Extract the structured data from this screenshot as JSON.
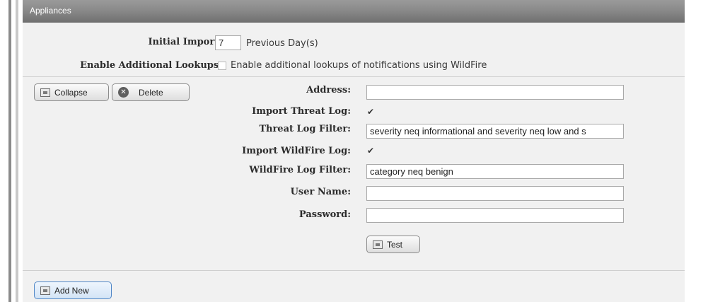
{
  "header": {
    "title": "Appliances"
  },
  "general": {
    "initial_import_label": "Initial Import:",
    "initial_import_value": "7",
    "initial_import_unit": "Previous Day(s)",
    "enable_lookups_label": "Enable Additional Lookups:",
    "enable_lookups_text": "Enable additional lookups of notifications using WildFire",
    "enable_lookups_checked": false
  },
  "appliance": {
    "collapse_label": "Collapse",
    "delete_label": "Delete",
    "address_label": "Address:",
    "address_value": "",
    "import_threat_label": "Import Threat Log:",
    "import_threat_checked": true,
    "threat_filter_label": "Threat Log Filter:",
    "threat_filter_value": "severity neq informational and severity neq low and s",
    "import_wildfire_label": "Import WildFire Log:",
    "import_wildfire_checked": true,
    "wildfire_filter_label": "WildFire Log Filter:",
    "wildfire_filter_value": "category neq benign",
    "username_label": "User Name:",
    "username_value": "",
    "password_label": "Password:",
    "password_value": "",
    "test_label": "Test"
  },
  "footer": {
    "add_new_label": "Add New"
  },
  "icons": {
    "collapse": "collapse-icon",
    "delete": "delete-icon",
    "test": "test-icon",
    "add": "add-icon",
    "check": "checkmark-icon"
  }
}
